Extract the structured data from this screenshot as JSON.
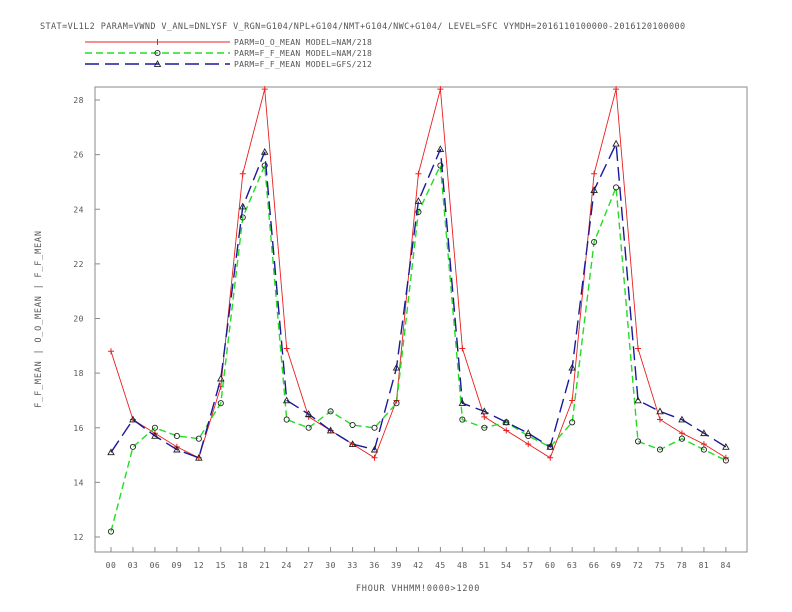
{
  "chart_data": {
    "type": "line",
    "title": "STAT=VL1L2 PARAM=VWND V_ANL=DNLYSF V_RGN=G104/NPL+G104/NMT+G104/NWC+G104/ LEVEL=SFC VYMDH=2016110100000-2016120100000",
    "xlabel": "FHOUR VHHMM!0000>1200",
    "ylabel": "F_F_MEAN | O_O_MEAN | F_F_MEAN",
    "ylim": [
      12,
      28
    ],
    "yticks": [
      "12",
      "14",
      "16",
      "18",
      "20",
      "22",
      "24",
      "26",
      "28"
    ],
    "categories": [
      "00",
      "03",
      "06",
      "09",
      "12",
      "15",
      "18",
      "21",
      "24",
      "27",
      "30",
      "33",
      "36",
      "39",
      "42",
      "45",
      "48",
      "51",
      "54",
      "57",
      "60",
      "63",
      "66",
      "69",
      "72",
      "75",
      "78",
      "81",
      "84"
    ],
    "series": [
      {
        "name": "PARM=O_O_MEAN MODEL=NAM/218",
        "color": "#e82020",
        "dash": "solid",
        "marker": "plus",
        "values": [
          18.8,
          16.3,
          15.8,
          15.3,
          14.9,
          17.5,
          25.3,
          28.4,
          18.9,
          16.4,
          15.9,
          15.4,
          14.9,
          17.0,
          25.3,
          28.4,
          18.9,
          16.4,
          15.9,
          15.4,
          14.9,
          17.0,
          25.3,
          28.4,
          18.9,
          16.3,
          15.8,
          15.4,
          14.9
        ]
      },
      {
        "name": "PARM=F_F_MEAN MODEL=NAM/218",
        "color": "#22dd22",
        "dash": "dashed",
        "marker": "circle",
        "values": [
          12.2,
          15.3,
          16.0,
          15.7,
          15.6,
          16.9,
          23.7,
          25.6,
          16.3,
          16.0,
          16.6,
          16.1,
          16.0,
          16.9,
          23.9,
          25.6,
          16.3,
          16.0,
          16.2,
          15.7,
          15.3,
          16.2,
          22.8,
          24.8,
          15.5,
          15.2,
          15.6,
          15.2,
          14.8
        ]
      },
      {
        "name": "PARM=F_F_MEAN MODEL=GFS/212",
        "color": "#1a1a99",
        "dash": "longdash",
        "marker": "triangle",
        "values": [
          15.1,
          16.3,
          15.7,
          15.2,
          14.9,
          17.8,
          24.1,
          26.1,
          17.0,
          16.5,
          15.9,
          15.4,
          15.2,
          18.2,
          24.3,
          26.2,
          16.9,
          16.6,
          16.2,
          15.8,
          15.3,
          18.2,
          24.7,
          26.4,
          17.0,
          16.6,
          16.3,
          15.8,
          15.3
        ]
      }
    ],
    "grid": false,
    "legend_position": "top-left"
  }
}
